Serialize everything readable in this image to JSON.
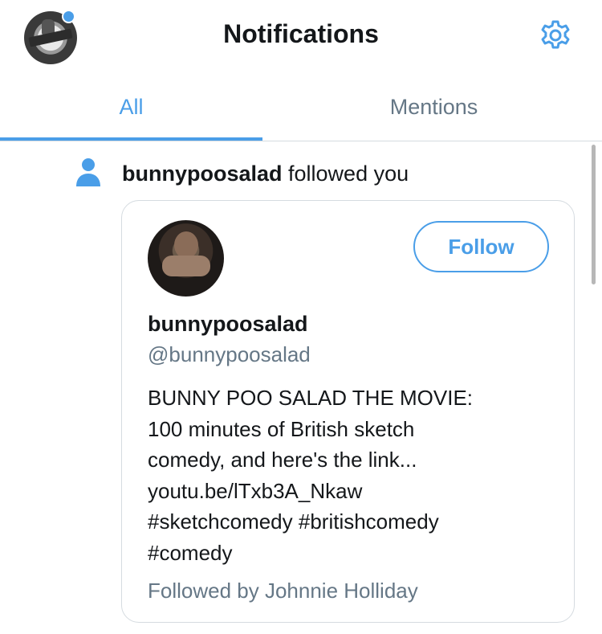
{
  "header": {
    "title": "Notifications",
    "avatar_icon": "podcast-logo-avatar",
    "settings_icon": "gear-icon",
    "accent_color": "#4a9ee8"
  },
  "tabs": [
    {
      "label": "All",
      "active": true
    },
    {
      "label": "Mentions",
      "active": false
    }
  ],
  "notification": {
    "icon": "person-icon",
    "username": "bunnypoosalad",
    "action_text": "followed you"
  },
  "profile_card": {
    "follow_label": "Follow",
    "display_name": "bunnypoosalad",
    "handle": "@bunnypoosalad",
    "bio_lines": [
      "BUNNY POO SALAD THE MOVIE:",
      "100 minutes of British sketch",
      "comedy, and here's the link...",
      "youtu.be/lTxb3A_Nkaw",
      "#sketchcomedy #britishcomedy",
      "#comedy"
    ],
    "followed_by": "Followed by Johnnie Holliday"
  }
}
